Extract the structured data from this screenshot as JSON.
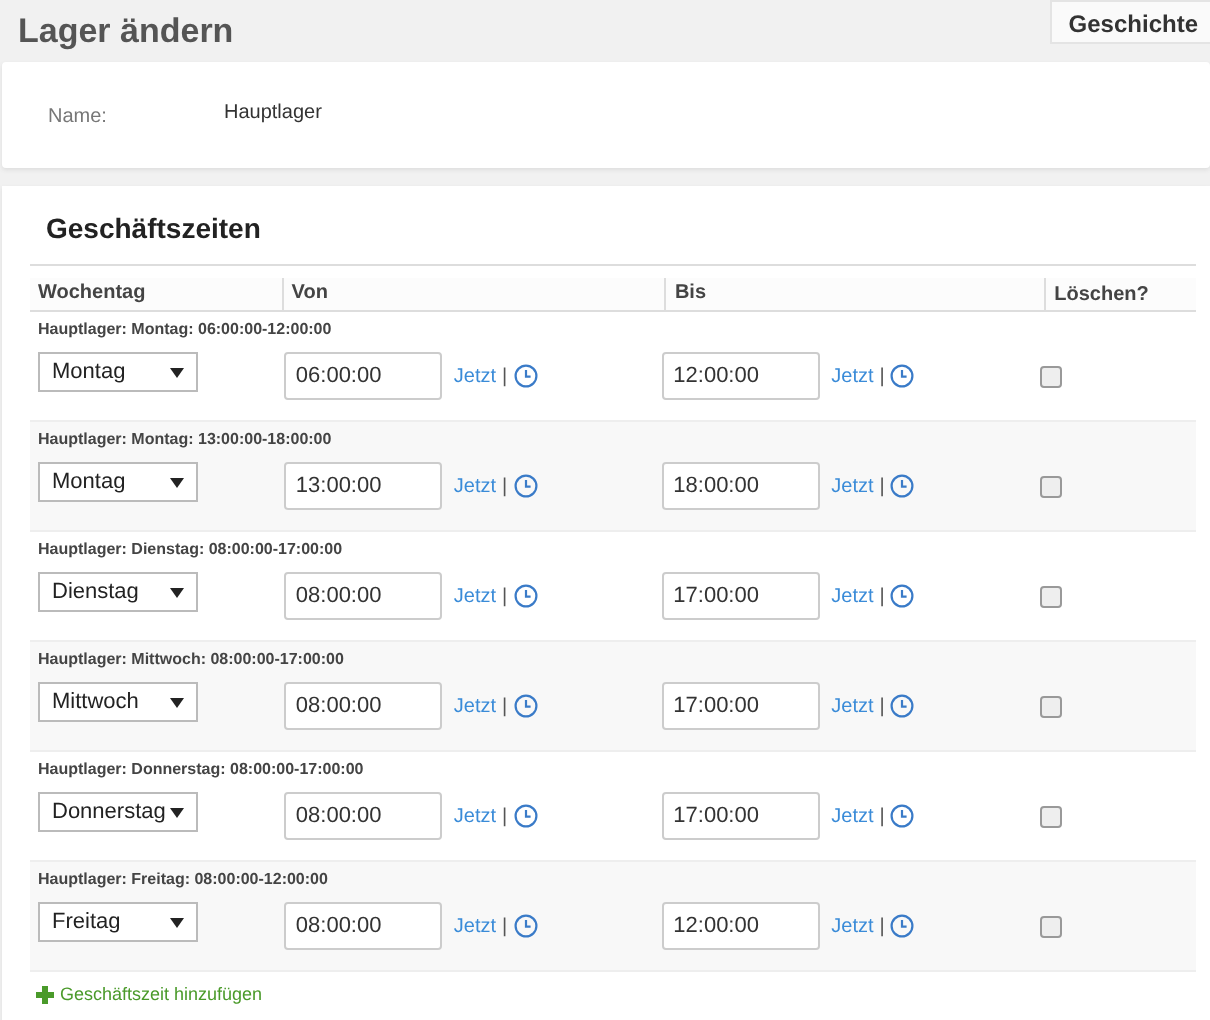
{
  "page": {
    "title": "Lager ändern",
    "history_button": "Geschichte"
  },
  "info": {
    "label": "Name:",
    "value": "Hauptlager"
  },
  "business_hours": {
    "title": "Geschäftszeiten",
    "columns": [
      "Wochentag",
      "Von",
      "Bis",
      "Löschen?"
    ],
    "rows": [
      {
        "caption": "Hauptlager: Montag: 06:00:00-12:00:00",
        "day": "Montag",
        "from": {
          "value": "06:00:00",
          "now_link": "Jetzt",
          "separator": "|"
        },
        "to": {
          "value": "12:00:00",
          "now_link": "Jetzt",
          "separator": "|"
        },
        "delete_checked": false
      },
      {
        "caption": "Hauptlager: Montag: 13:00:00-18:00:00",
        "day": "Montag",
        "from": {
          "value": "13:00:00",
          "now_link": "Jetzt",
          "separator": "|"
        },
        "to": {
          "value": "18:00:00",
          "now_link": "Jetzt",
          "separator": "|"
        },
        "delete_checked": false
      },
      {
        "caption": "Hauptlager: Dienstag: 08:00:00-17:00:00",
        "day": "Dienstag",
        "from": {
          "value": "08:00:00",
          "now_link": "Jetzt",
          "separator": "|"
        },
        "to": {
          "value": "17:00:00",
          "now_link": "Jetzt",
          "separator": "|"
        },
        "delete_checked": false
      },
      {
        "caption": "Hauptlager: Mittwoch: 08:00:00-17:00:00",
        "day": "Mittwoch",
        "from": {
          "value": "08:00:00",
          "now_link": "Jetzt",
          "separator": "|"
        },
        "to": {
          "value": "17:00:00",
          "now_link": "Jetzt",
          "separator": "|"
        },
        "delete_checked": false
      },
      {
        "caption": "Hauptlager: Donnerstag: 08:00:00-17:00:00",
        "day": "Donnerstag",
        "from": {
          "value": "08:00:00",
          "now_link": "Jetzt",
          "separator": "|"
        },
        "to": {
          "value": "17:00:00",
          "now_link": "Jetzt",
          "separator": "|"
        },
        "delete_checked": false
      },
      {
        "caption": "Hauptlager: Freitag: 08:00:00-12:00:00",
        "day": "Freitag",
        "from": {
          "value": "08:00:00",
          "now_link": "Jetzt",
          "separator": "|"
        },
        "to": {
          "value": "12:00:00",
          "now_link": "Jetzt",
          "separator": "|"
        },
        "delete_checked": false
      }
    ],
    "add_link": "Geschäftszeit hinzufügen"
  }
}
